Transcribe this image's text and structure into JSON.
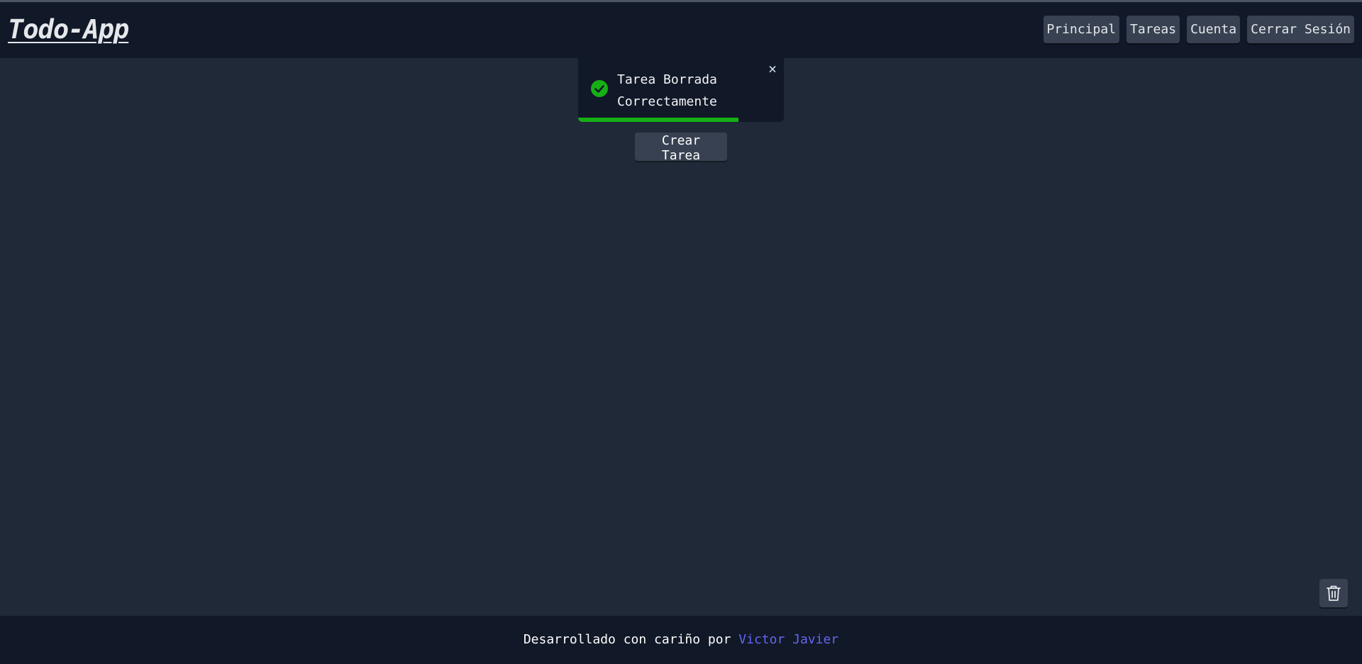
{
  "header": {
    "logo": "Todo-App",
    "nav": {
      "principal": "Principal",
      "tareas": "Tareas",
      "cuenta": "Cuenta",
      "cerrar_sesion": "Cerrar Sesión"
    }
  },
  "toast": {
    "line1": "Tarea Borrada",
    "line2": "Correctamente",
    "close_glyph": "×",
    "icon": "check-circle-icon",
    "progress": 0.78,
    "color": "#16b016"
  },
  "main": {
    "create_label": "Crear Tarea",
    "trash_icon": "trash-icon"
  },
  "footer": {
    "text": "Desarrollado con cariño por ",
    "author": "Victor Javier",
    "link_color": "#6366f1"
  },
  "colors": {
    "background": "#1f2937",
    "header": "#111827",
    "button": "#374151"
  }
}
